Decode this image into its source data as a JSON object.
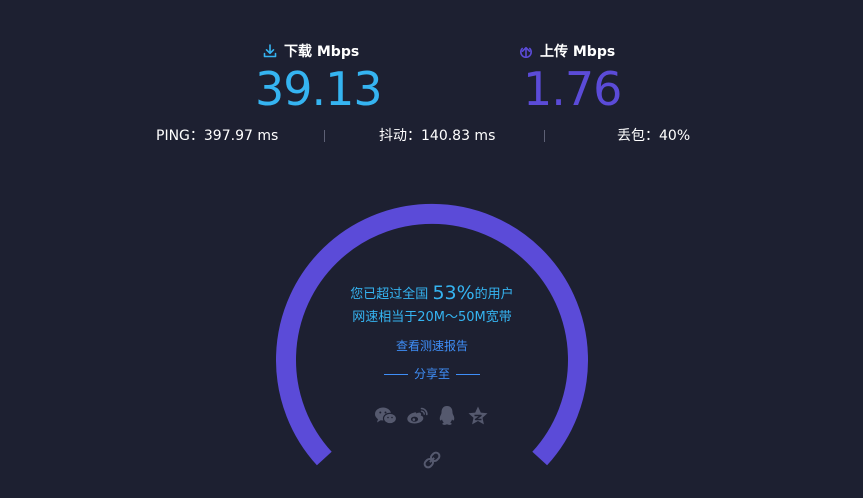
{
  "download": {
    "label": "下载 Mbps",
    "value": "39.13",
    "color": "#35b4f1",
    "icon": "download-arrow-icon"
  },
  "upload": {
    "label": "上传 Mbps",
    "value": "1.76",
    "color": "#5b4bd8",
    "icon": "upload-arrow-icon"
  },
  "stats": {
    "ping": "PING：397.97 ms",
    "jitter": "抖动：140.83 ms",
    "loss": "丢包：40%"
  },
  "gauge": {
    "color": "#5b4bd8",
    "percent_prefix": "您已超过全国 ",
    "percent": "53%",
    "percent_suffix": "的用户",
    "bandwidth": "网速相当于20M～50M宽带",
    "report_link": "查看测速报告",
    "share_label": "分享至"
  },
  "share_icons": [
    "wechat-icon",
    "weibo-icon",
    "qq-icon",
    "qzone-star-icon",
    "copy-link-icon"
  ],
  "colors": {
    "background": "#1d2031",
    "accent_blue": "#35b4f1",
    "accent_purple": "#5b4bd8",
    "link_blue": "#3f8ef7",
    "muted_icon": "#55596e"
  }
}
